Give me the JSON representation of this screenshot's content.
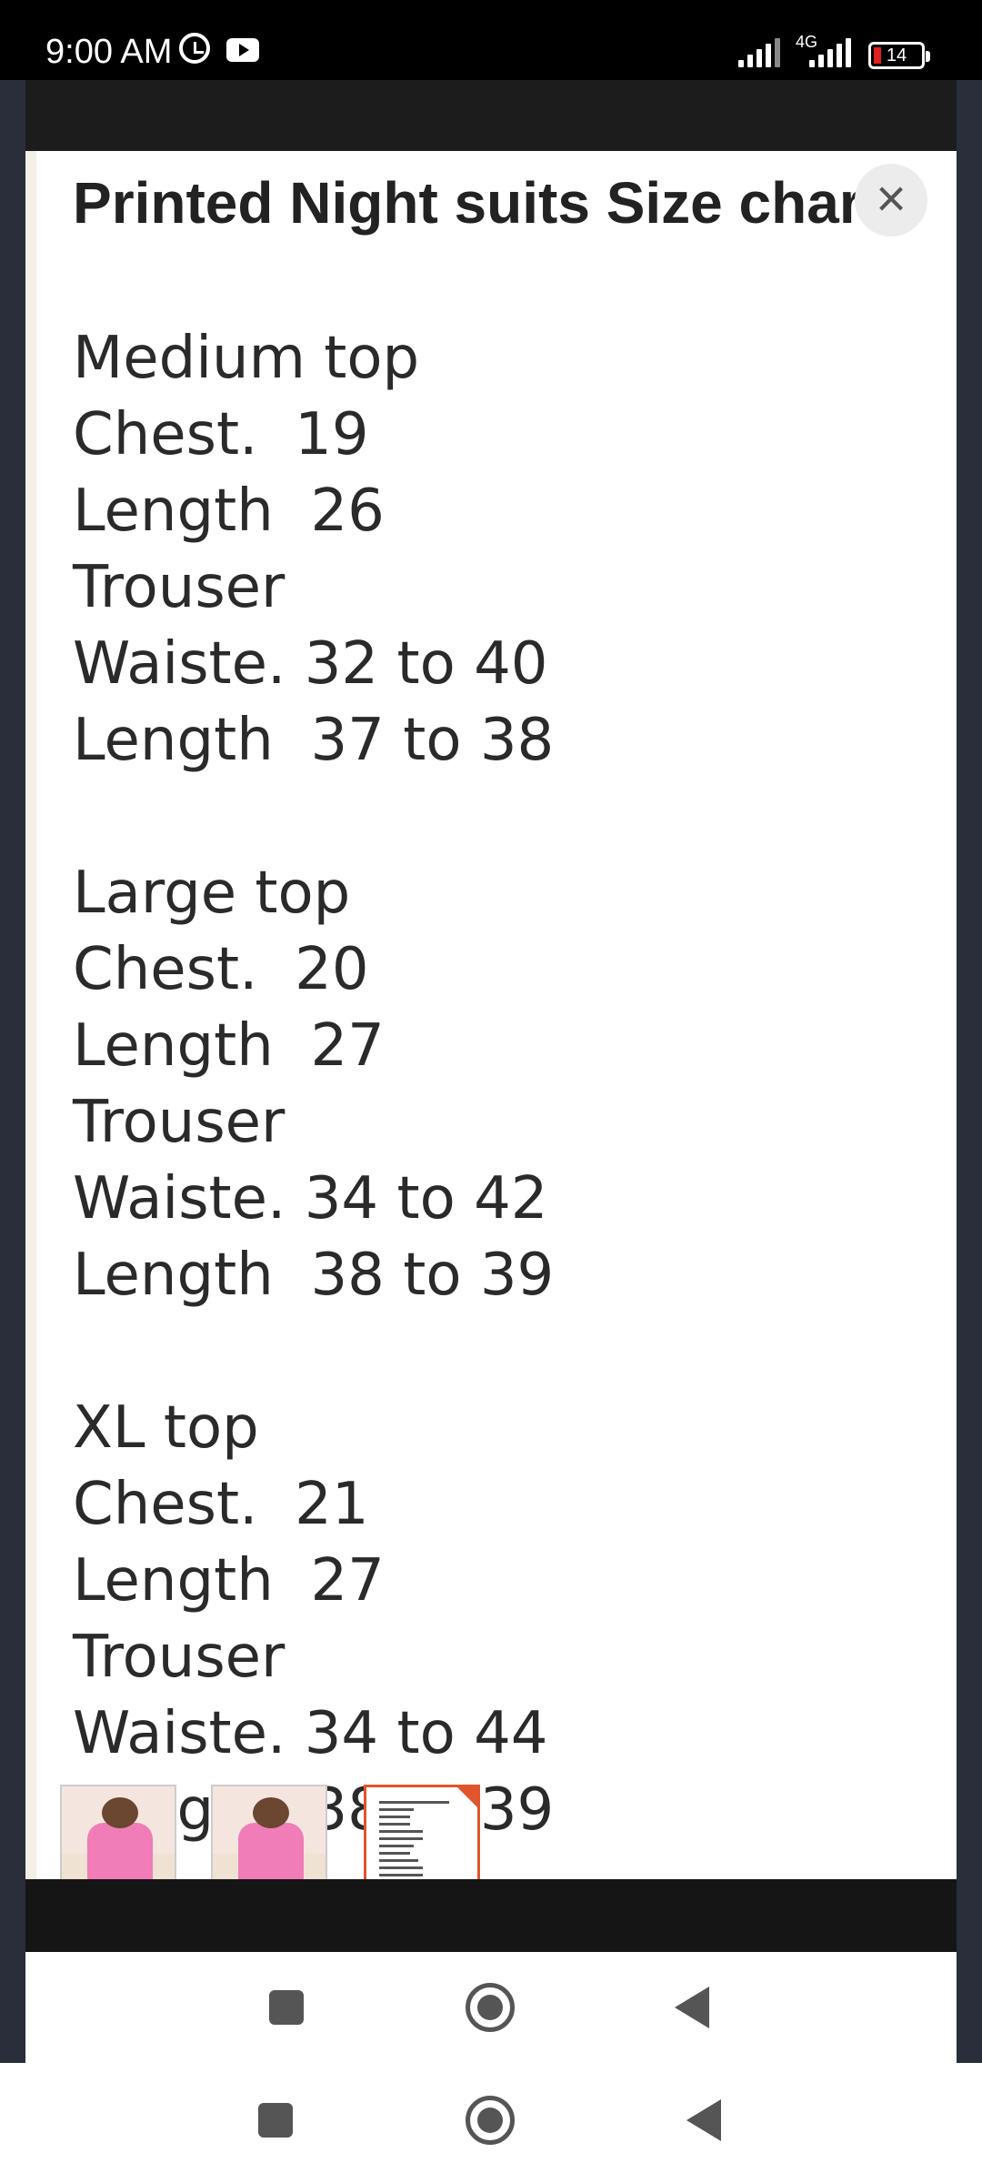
{
  "status_bar": {
    "time": "9:00 AM",
    "network": "4G",
    "battery": "14"
  },
  "viewer": {
    "title": "Printed Night suits Size chart",
    "close_icon": "×",
    "lines": [
      "Medium top",
      "Chest.  19",
      "Length  26",
      "Trouser",
      "Waiste. 32 to 40",
      "Length  37 to 38",
      "",
      "Large top",
      "Chest.  20",
      "Length  27",
      "Trouser",
      "Waiste. 34 to 42",
      "Length  38 to 39",
      "",
      "XL top",
      "Chest.  21",
      "Length  27",
      "Trouser",
      "Waiste. 34 to 44",
      "Length  38 to 39"
    ]
  },
  "thumbnails": [
    {
      "name": "thumbnail-1",
      "selected": false
    },
    {
      "name": "thumbnail-2",
      "selected": false
    },
    {
      "name": "thumbnail-3",
      "selected": true
    }
  ],
  "colors": {
    "accent": "#e0552b",
    "status_bar": "#000000",
    "battery_low": "#e02020"
  }
}
